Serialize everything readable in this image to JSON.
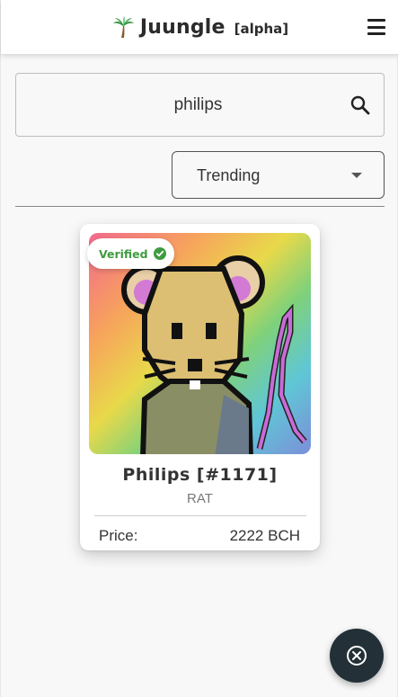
{
  "header": {
    "logo_icon": "palm-tree-icon",
    "title": "Juungle",
    "tag": "[alpha]",
    "menu_icon": "hamburger-menu-icon"
  },
  "search": {
    "value": "philips",
    "icon": "search-icon"
  },
  "sort": {
    "selected": "Trending",
    "icon": "caret-down-icon"
  },
  "listing": {
    "verified_label": "Verified",
    "verified_icon": "check-circle-icon",
    "verified_color": "#3f9b3f",
    "name": "Philips [#1171]",
    "collection": "RAT",
    "price_label": "Price:",
    "price_value": "2222 BCH",
    "image_description_icon": "pixel-rat-nft-image"
  },
  "fab": {
    "icon": "close-circle-icon",
    "color": "#233038"
  }
}
